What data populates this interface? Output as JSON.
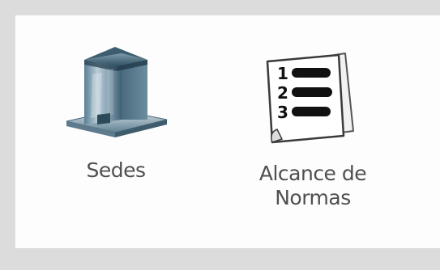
{
  "items": [
    {
      "label": "Sedes",
      "icon": "building-icon"
    },
    {
      "label_line1": "Alcance de",
      "label_line2": "Normas",
      "icon": "numbered-list-document-icon"
    }
  ],
  "colors": {
    "background": "#dcdcdc",
    "panel": "#fdfdfd",
    "label_text": "#4f4f4f"
  }
}
